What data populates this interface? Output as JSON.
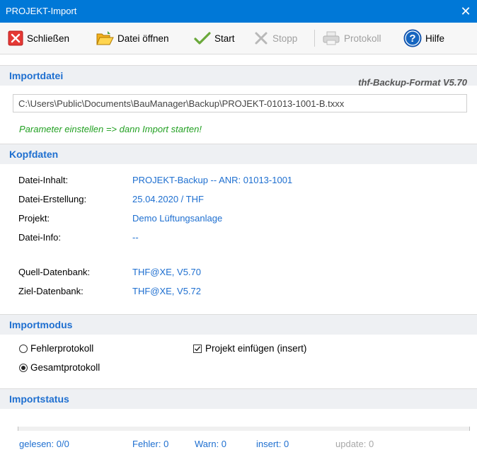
{
  "window": {
    "title": "PROJEKT-Import"
  },
  "toolbar": {
    "close_label": "Schließen",
    "open_label": "Datei öffnen",
    "start_label": "Start",
    "stop_label": "Stopp",
    "log_label": "Protokoll",
    "help_label": "Hilfe"
  },
  "importdatei": {
    "heading": "Importdatei",
    "format": "thf-Backup-Format V5.70",
    "path": "C:\\Users\\Public\\Documents\\BauManager\\Backup\\PROJEKT-01013-1001-B.txxx",
    "hint": "Parameter einstellen => dann Import starten!"
  },
  "kopfdaten": {
    "heading": "Kopfdaten",
    "rows": [
      {
        "label": "Datei-Inhalt:",
        "value": "PROJEKT-Backup -- ANR: 01013-1001"
      },
      {
        "label": "Datei-Erstellung:",
        "value": "25.04.2020 / THF"
      },
      {
        "label": "Projekt:",
        "value": "Demo Lüftungsanlage"
      },
      {
        "label": "Datei-Info:",
        "value": "--"
      },
      {
        "label": "Quell-Datenbank:",
        "value": "THF@XE, V5.70"
      },
      {
        "label": "Ziel-Datenbank:",
        "value": "THF@XE, V5.72"
      }
    ]
  },
  "importmodus": {
    "heading": "Importmodus",
    "option_error": "Fehlerprotokoll",
    "option_full": "Gesamtprotokoll",
    "selected": "Gesamtprotokoll",
    "insert_label": "Projekt einfügen (insert)",
    "insert_checked": true
  },
  "importstatus": {
    "heading": "Importstatus",
    "progress": 0,
    "read": "gelesen: 0/0",
    "errors": "Fehler: 0",
    "warnings": "Warn: 0",
    "inserts": "insert: 0",
    "updates": "update: 0"
  },
  "colors": {
    "titlebar": "#0078d7",
    "accent": "#1e6fd0",
    "hint": "#22a022",
    "section_bg": "#eef0f3"
  }
}
